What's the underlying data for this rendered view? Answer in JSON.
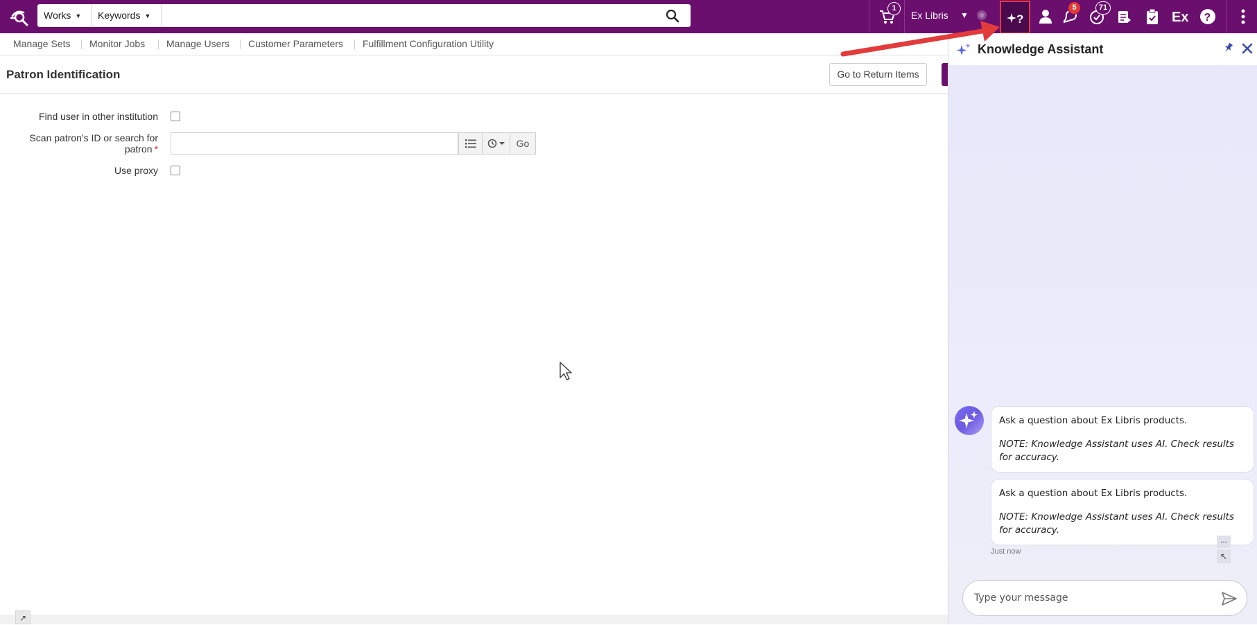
{
  "topbar": {
    "search_scope": "Works",
    "search_field": "Keywords",
    "search_value": "",
    "cart_count": "1",
    "institution": "Ex Libris",
    "notifications_count": "5",
    "tasks_count": "71",
    "icons": [
      "logo-icon",
      "search-icon",
      "cart-icon",
      "knowledge-assistant-icon",
      "user-icon",
      "notifications-icon",
      "tasks-icon",
      "slips-icon",
      "clipboard-icon",
      "ex-libris-icon",
      "help-icon",
      "more-vertical-icon"
    ]
  },
  "subnav": {
    "items": [
      "Manage Sets",
      "Monitor Jobs",
      "Manage Users",
      "Customer Parameters",
      "Fulfillment Configuration Utility"
    ]
  },
  "page": {
    "title": "Patron Identification",
    "return_button": "Go to Return Items"
  },
  "form": {
    "find_user_label": "Find user in other institution",
    "scan_label_line1": "Scan patron's ID or search for",
    "scan_label_line2": "patron",
    "required_mark": "*",
    "use_proxy_label": "Use proxy",
    "patron_value": "",
    "go_label": "Go"
  },
  "assistant": {
    "title": "Knowledge Assistant",
    "messages": [
      {
        "text": "Ask a question about Ex Libris products.",
        "note": "NOTE: Knowledge Assistant uses AI. Check results for accuracy."
      },
      {
        "text": "Ask a question about Ex Libris products.",
        "note": "NOTE: Knowledge Assistant uses AI. Check results for accuracy."
      }
    ],
    "timestamp": "Just now",
    "more_label": "...",
    "input_placeholder": "Type your message"
  },
  "colors": {
    "brand": "#6b0f6f",
    "badge_red": "#e53935",
    "annotation_red": "#e23b3b",
    "assistant_bg": "#e9e9fa"
  }
}
